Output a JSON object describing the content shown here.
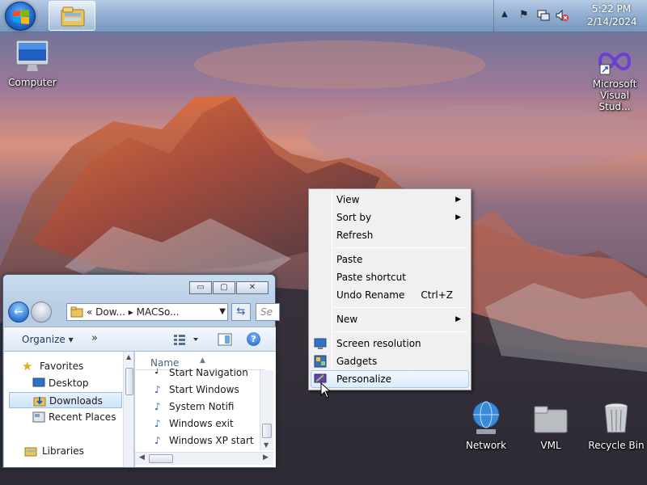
{
  "taskbar": {
    "start_icon": "windows-logo",
    "pinned": [
      {
        "name": "windows-explorer",
        "icon": "folder-library-icon"
      }
    ],
    "tray": {
      "icons": [
        "show-hidden-icons-arrow",
        "action-center-flag-icon",
        "network-icon",
        "volume-muted-icon"
      ],
      "time": "5:22 PM",
      "date": "2/14/2024"
    }
  },
  "desktop_icons": {
    "computer": "Computer",
    "visual_studio_line1": "Microsoft",
    "visual_studio_line2": "Visual Stud...",
    "network": "Network",
    "vml": "VML",
    "recycle_bin": "Recycle Bin"
  },
  "explorer": {
    "window_buttons": {
      "minimize": "▭",
      "maximize": "▢",
      "close": "✕"
    },
    "address": {
      "prefix": "«",
      "segment1": "Dow...",
      "separator": "▸",
      "segment2": "MACSo..."
    },
    "search_placeholder": "Se",
    "toolbar": {
      "organize": "Organize ▾",
      "more": "»"
    },
    "nav_pane": {
      "favorites": "Favorites",
      "desktop": "Desktop",
      "downloads": "Downloads",
      "recent_places": "Recent Places",
      "libraries": "Libraries"
    },
    "column_header": "Name",
    "files": [
      "Start Navigation",
      "Start Windows",
      "System Notifi",
      "Windows exit",
      "Windows XP start"
    ]
  },
  "context_menu": {
    "view": "View",
    "sort_by": "Sort by",
    "refresh": "Refresh",
    "paste": "Paste",
    "paste_shortcut": "Paste shortcut",
    "undo_rename": "Undo Rename",
    "undo_shortcut": "Ctrl+Z",
    "new": "New",
    "screen_resolution": "Screen resolution",
    "gadgets": "Gadgets",
    "personalize": "Personalize",
    "submenu_arrow": "▶"
  },
  "colors": {
    "taskbar": "#9fb8d6",
    "menu_bg": "#f0f0f0",
    "menu_hover": "#dceaf9",
    "selection": "#cde2f8"
  }
}
